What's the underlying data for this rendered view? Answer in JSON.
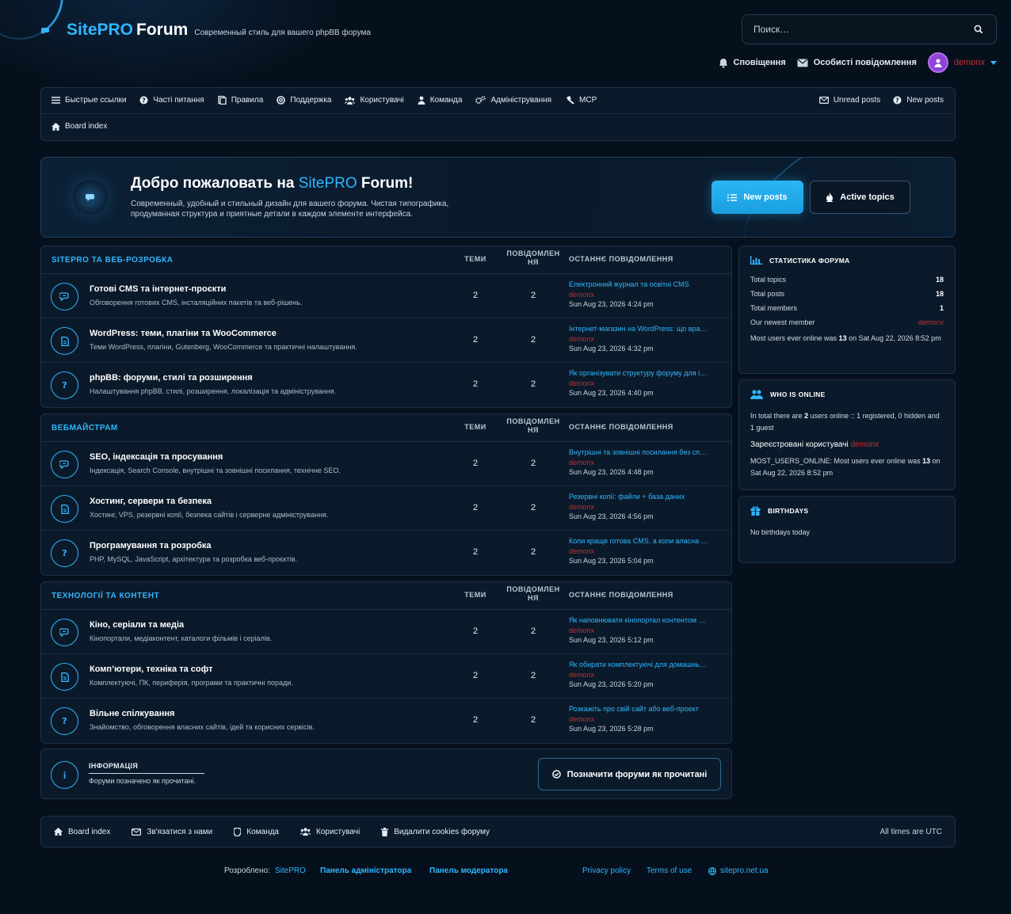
{
  "header": {
    "site_name": "SitePRO",
    "site_name2": "Forum",
    "description": "Современный стиль для вашего phpBB форума",
    "search_placeholder": "Поиск…",
    "notifications": "Сповіщення",
    "messages": "Особисті повідомлення",
    "username": "demonx"
  },
  "nav": {
    "items": [
      "Быстрые ссылки",
      "Часті питання",
      "Правила",
      "Поддержка",
      "Користувачі",
      "Команда",
      "Адміністрування",
      "MCP"
    ],
    "right": [
      "Unread posts",
      "New posts"
    ],
    "breadcrumb": "Board index"
  },
  "welcome": {
    "title_prefix": "Добро пожаловать на",
    "title_highlight": "SitePRO",
    "title_suffix": "Forum!",
    "text": "Современный, удобный и стильный дизайн для вашего форума. Чистая типографика, продуманная структура и приятные детали в каждом элементе интерфейса.",
    "btn_new": "New posts",
    "btn_active": "Active topics"
  },
  "columns": {
    "topics": "ТЕМИ",
    "posts": "ПОВІДОМЛЕННЯ",
    "last": "ОСТАННЄ ПОВІДОМЛЕННЯ"
  },
  "categories": [
    {
      "name": "SITEPRO ТА ВЕБ-РОЗРОБКА",
      "forums": [
        {
          "title": "Готові CMS та інтернет-проєкти",
          "desc": "Обговорення готових CMS, інсталяційних пакетів та веб-рішень.",
          "topics": "2",
          "posts": "2",
          "last_title": "Електронний журнал та освітні CMS",
          "last_author": "demonx",
          "last_date": "Sun Aug 23, 2026 4:24 pm",
          "icon": "chat-icon"
        },
        {
          "title": "WordPress: теми, плагіни та WooCommerce",
          "desc": "Теми WordPress, плагіни, Gutenberg, WooCommerce та практичні налаштування.",
          "topics": "2",
          "posts": "2",
          "last_title": "Інтернет-магазин на WordPress: що вра…",
          "last_author": "demonx",
          "last_date": "Sun Aug 23, 2026 4:32 pm",
          "icon": "document-icon"
        },
        {
          "title": "phpBB: форуми, стилі та розширення",
          "desc": "Налаштування phpBB, стилі, розширення, локалізація та адміністрування.",
          "topics": "2",
          "posts": "2",
          "last_title": "Як організувати структуру форуму для і…",
          "last_author": "demonx",
          "last_date": "Sun Aug 23, 2026 4:40 pm",
          "icon": "question-icon"
        }
      ]
    },
    {
      "name": "ВЕБМАЙСТРАМ",
      "forums": [
        {
          "title": "SEO, індексація та просування",
          "desc": "Індексація, Search Console, внутрішні та зовнішні посилання, технічне SEO.",
          "topics": "2",
          "posts": "2",
          "last_title": "Внутрішні та зовнішні посилання без сп…",
          "last_author": "demonx",
          "last_date": "Sun Aug 23, 2026 4:48 pm",
          "icon": "chat-icon"
        },
        {
          "title": "Хостинг, сервери та безпека",
          "desc": "Хостинг, VPS, резервні копії, безпека сайтів і серверне адміністрування.",
          "topics": "2",
          "posts": "2",
          "last_title": "Резервні копії: файли + база даних",
          "last_author": "demonx",
          "last_date": "Sun Aug 23, 2026 4:56 pm",
          "icon": "document-icon"
        },
        {
          "title": "Програмування та розробка",
          "desc": "PHP, MySQL, JavaScript, архітектура та розробка веб-проєктів.",
          "topics": "2",
          "posts": "2",
          "last_title": "Коли краще готова CMS, а коли власна …",
          "last_author": "demonx",
          "last_date": "Sun Aug 23, 2026 5:04 pm",
          "icon": "question-icon"
        }
      ]
    },
    {
      "name": "ТЕХНОЛОГІЇ ТА КОНТЕНТ",
      "forums": [
        {
          "title": "Кіно, серіали та медіа",
          "desc": "Кінопортали, медіаконтент, каталоги фільмів і серіалів.",
          "topics": "2",
          "posts": "2",
          "last_title": "Як наповнювати кінопортал контентом …",
          "last_author": "demonx",
          "last_date": "Sun Aug 23, 2026 5:12 pm",
          "icon": "chat-icon"
        },
        {
          "title": "Комп’ютери, техніка та софт",
          "desc": "Комплектуючі, ПК, периферія, програми та практичні поради.",
          "topics": "2",
          "posts": "2",
          "last_title": "Як обирати комплектуючі для домашнь…",
          "last_author": "demonx",
          "last_date": "Sun Aug 23, 2026 5:20 pm",
          "icon": "document-icon"
        },
        {
          "title": "Вільне спілкування",
          "desc": "Знайомство, обговорення власних сайтів, ідей та корисних сервісів.",
          "topics": "2",
          "posts": "2",
          "last_title": "Розкажіть про свій сайт або веб-проект",
          "last_author": "demonx",
          "last_date": "Sun Aug 23, 2026 5:28 pm",
          "icon": "question-icon"
        }
      ]
    }
  ],
  "info": {
    "heading": "ІНФОРМАЦІЯ",
    "text": "Форуми позначено як прочитані.",
    "button": "Позначити форуми як прочитані"
  },
  "stats": {
    "heading": "СТАТИСТИКА ФОРУМА",
    "rows": [
      {
        "label": "Total topics",
        "value": "18"
      },
      {
        "label": "Total posts",
        "value": "18"
      },
      {
        "label": "Total members",
        "value": "1"
      },
      {
        "label": "Our newest member",
        "value": "demonx"
      }
    ],
    "record_prefix": "Most users ever online was",
    "record_count": "13",
    "record_suffix": "on Sat Aug 22, 2026 8:52 pm"
  },
  "online": {
    "heading": "WHO IS ONLINE",
    "text_prefix": "In total there are",
    "text_count": "2",
    "text_suffix": "users online :: 1 registered, 0 hidden and 1 guest",
    "registered_label": "Зареєстровані користувачі",
    "registered_user": "demonx",
    "record_prefix": "MOST_USERS_ONLINE: Most users ever online was",
    "record_count": "13",
    "record_suffix": "on Sat Aug 22, 2026 8:52 pm"
  },
  "birthdays": {
    "heading": "BIRTHDAYS",
    "text": "No birthdays today"
  },
  "footer": {
    "links": [
      "Board index",
      "Зв'язатися з нами",
      "Команда",
      "Користувачі",
      "Видалити cookies форуму"
    ],
    "timezone": "All times are UTC",
    "dev_label": "Розроблено:",
    "dev_name": "SitePRO",
    "admin_panel": "Панель адміністратора",
    "mod_panel": "Панель модератора",
    "privacy": "Privacy policy",
    "terms": "Terms of use",
    "domain": "sitepro.net.ua"
  },
  "colors": {
    "accent": "#2fb6ff",
    "background": "#06101c",
    "panel": "#0b1a2a",
    "username": "#cc2a2a"
  }
}
